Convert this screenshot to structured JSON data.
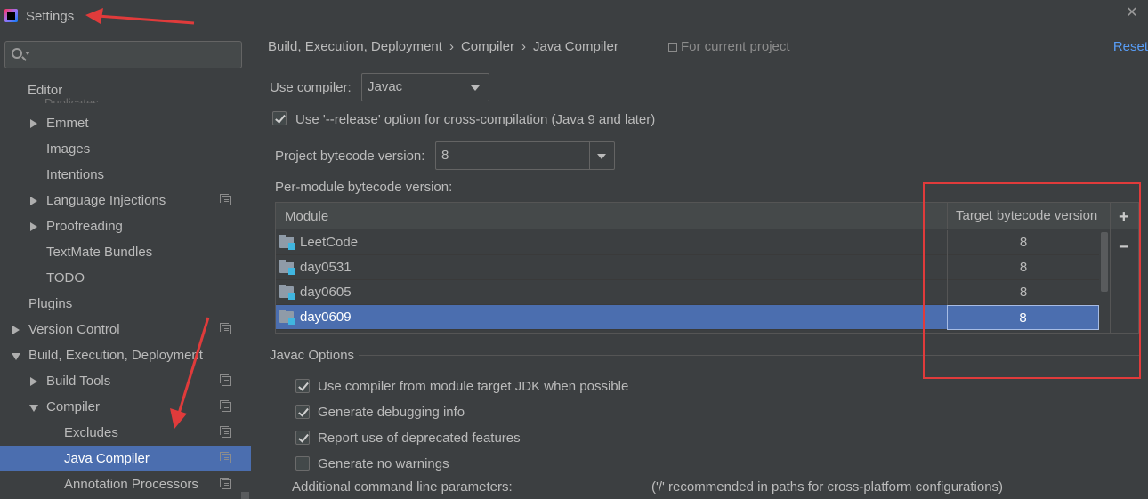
{
  "window": {
    "title": "Settings",
    "close_icon": "close-icon"
  },
  "sidebar": {
    "search_placeholder": "",
    "faded_item": "Duplicates",
    "items": [
      {
        "label": "Editor",
        "level": 0
      },
      {
        "label": "Emmet",
        "level": 1,
        "expandable": true
      },
      {
        "label": "Images",
        "level": 1
      },
      {
        "label": "Intentions",
        "level": 1
      },
      {
        "label": "Language Injections",
        "level": 1,
        "expandable": true,
        "project": true
      },
      {
        "label": "Proofreading",
        "level": 1,
        "expandable": true
      },
      {
        "label": "TextMate Bundles",
        "level": 1
      },
      {
        "label": "TODO",
        "level": 1
      },
      {
        "label": "Plugins",
        "level": 0
      },
      {
        "label": "Version Control",
        "level": 0,
        "expandable": true,
        "project": true
      },
      {
        "label": "Build, Execution, Deployment",
        "level": 0,
        "expanded": true
      },
      {
        "label": "Build Tools",
        "level": 1,
        "expandable": true,
        "project": true
      },
      {
        "label": "Compiler",
        "level": 1,
        "expanded": true,
        "project": true
      },
      {
        "label": "Excludes",
        "level": 2,
        "project": true
      },
      {
        "label": "Java Compiler",
        "level": 2,
        "project": true,
        "selected": true
      },
      {
        "label": "Annotation Processors",
        "level": 2,
        "project": true
      }
    ]
  },
  "main": {
    "breadcrumb": [
      "Build, Execution, Deployment",
      "Compiler",
      "Java Compiler"
    ],
    "breadcrumb_sep": "›",
    "for_current_project": "For current project",
    "reset": "Reset",
    "use_compiler_label": "Use compiler:",
    "use_compiler_value": "Javac",
    "release_option_label": "Use '--release' option for cross-compilation (Java 9 and later)",
    "release_option_checked": true,
    "project_bytecode_label": "Project bytecode version:",
    "project_bytecode_value": "8",
    "per_module_label": "Per-module bytecode version:",
    "table": {
      "columns": [
        "Module",
        "Target bytecode version"
      ],
      "rows": [
        {
          "module": "LeetCode",
          "target": "8"
        },
        {
          "module": "day0531",
          "target": "8"
        },
        {
          "module": "day0605",
          "target": "8"
        },
        {
          "module": "day0609",
          "target": "8",
          "selected": true
        }
      ],
      "add_label": "+",
      "remove_label": "−"
    },
    "javac_options_label": "Javac Options",
    "options": [
      {
        "label": "Use compiler from module target JDK when possible",
        "checked": true
      },
      {
        "label": "Generate debugging info",
        "checked": true
      },
      {
        "label": "Report use of deprecated features",
        "checked": true
      },
      {
        "label": "Generate no warnings",
        "checked": false
      }
    ],
    "additional_params_label": "Additional command line parameters:",
    "additional_params_hint": "('/' recommended in paths for cross-platform configurations)"
  },
  "colors": {
    "accent": "#4b6eaf",
    "link": "#589df6",
    "annotation": "#e03b3b"
  }
}
